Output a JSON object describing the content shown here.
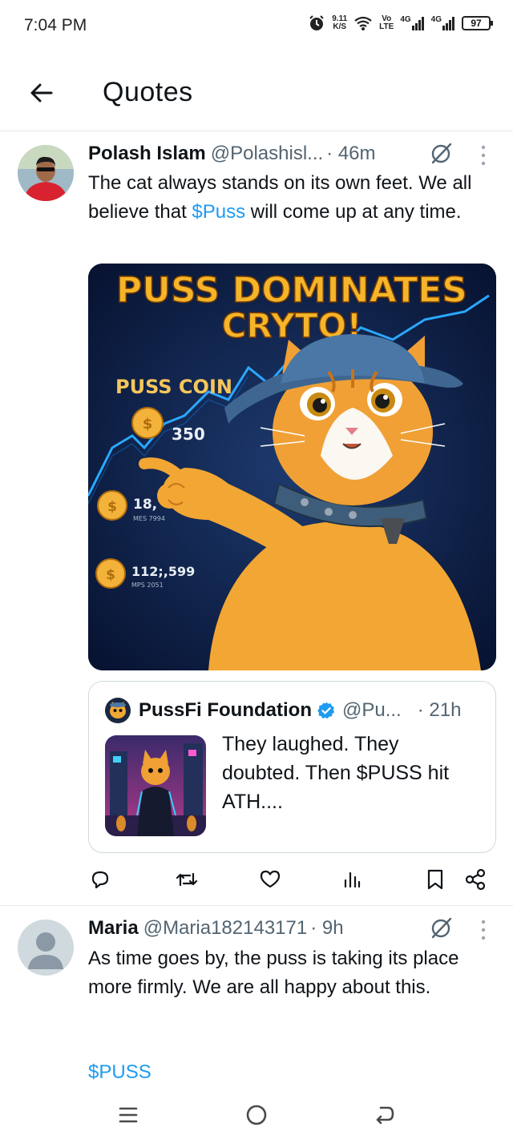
{
  "status_bar": {
    "time": "7:04 PM",
    "net_speed_value": "9.11",
    "net_speed_unit": "K/S",
    "volte_top": "Vo",
    "volte_bottom": "LTE",
    "sim1": "4G",
    "sim2": "4G",
    "battery": "97"
  },
  "header": {
    "title": "Quotes"
  },
  "tweets": [
    {
      "name": "Polash Islam",
      "handle": "@Polashisl...",
      "time": "· 46m",
      "text_part1": "The cat always stands on its own feet. We all believe that ",
      "cashtag": "$Puss",
      "text_part2": " will come up at any time.",
      "media": {
        "headline1": "PUSS DOMINATES",
        "headline2": "CRYTO!",
        "coin_label": "PUSS COIN",
        "coin_symbol": "$",
        "value_a": "350",
        "value_b": "18,",
        "value_b_sub": "MES 7994",
        "value_c": "112;,599",
        "value_c_sub": "MPS 2051"
      },
      "quote": {
        "name": "PussFi Foundation",
        "handle": "@Pu...",
        "time": "· 21h",
        "text": "They laughed. They doubted. Then $PUSS hit ATH...."
      }
    },
    {
      "name": "Maria",
      "handle": "@Maria182143171",
      "time": "· 9h",
      "text": "As time goes by, the puss is taking its place more firmly. We are all happy about this.",
      "cashtag_line": "$PUSS"
    }
  ],
  "colors": {
    "accent": "#1d9bf0",
    "text": "#0f1419",
    "secondary": "#536471",
    "verified": "#1d9bf0"
  },
  "icons": [
    "back-arrow-icon",
    "grok-icon",
    "more-icon",
    "reply-icon",
    "retweet-icon",
    "like-icon",
    "views-icon",
    "bookmark-icon",
    "share-icon",
    "verified-icon",
    "recent-apps-icon",
    "home-icon",
    "back-nav-icon"
  ]
}
